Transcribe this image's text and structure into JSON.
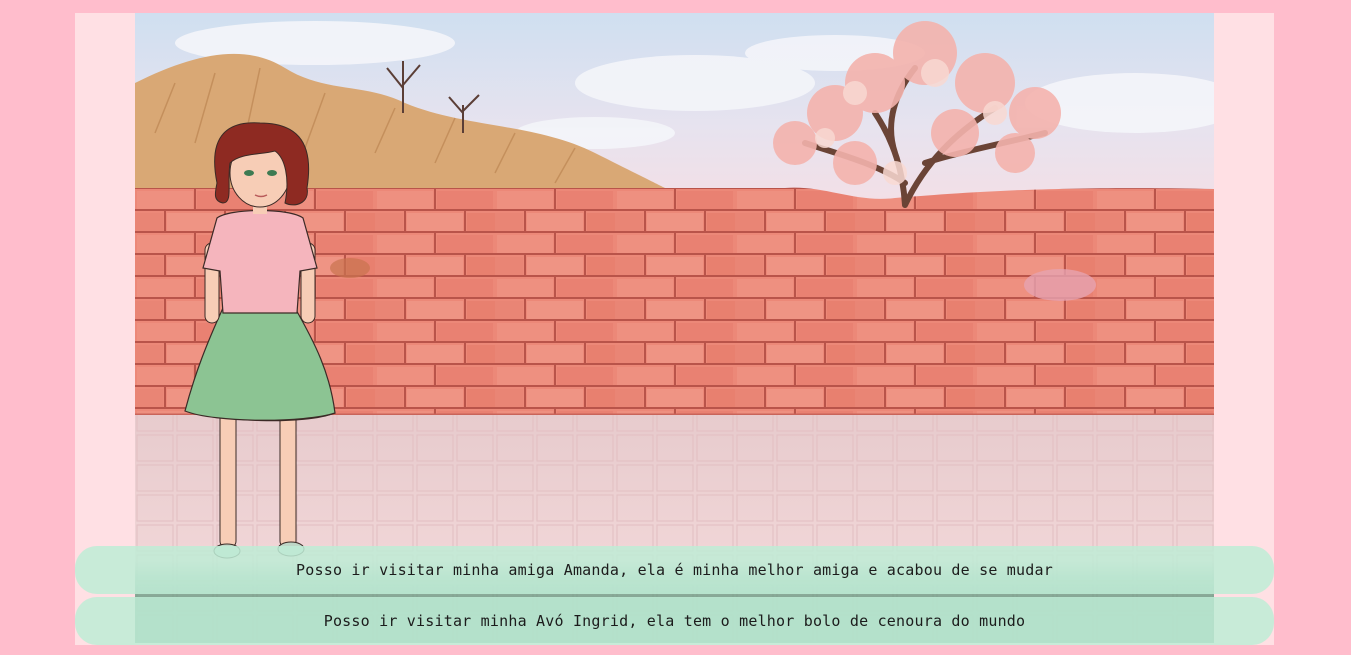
{
  "scene": {
    "wall_color": "#ec8a7a",
    "sky_color": "#dbe6f2",
    "ground_color": "#f0d1d3",
    "tree_blossom_color": "#f4b3ad",
    "character_shirt_color": "#f5b5bd",
    "character_skirt_color": "#8cc493",
    "character_hair_color": "#8e2a22"
  },
  "choices": [
    {
      "label": "Posso ir visitar minha amiga Amanda, ela é minha melhor amiga e acabou de se mudar"
    },
    {
      "label": "Posso ir visitar minha Avó Ingrid, ela tem o melhor bolo de cenoura do mundo"
    }
  ],
  "colors": {
    "page_background": "#ffbdcc",
    "frame_background": "#ffe0e4",
    "choice_background": "#bfecd6"
  }
}
